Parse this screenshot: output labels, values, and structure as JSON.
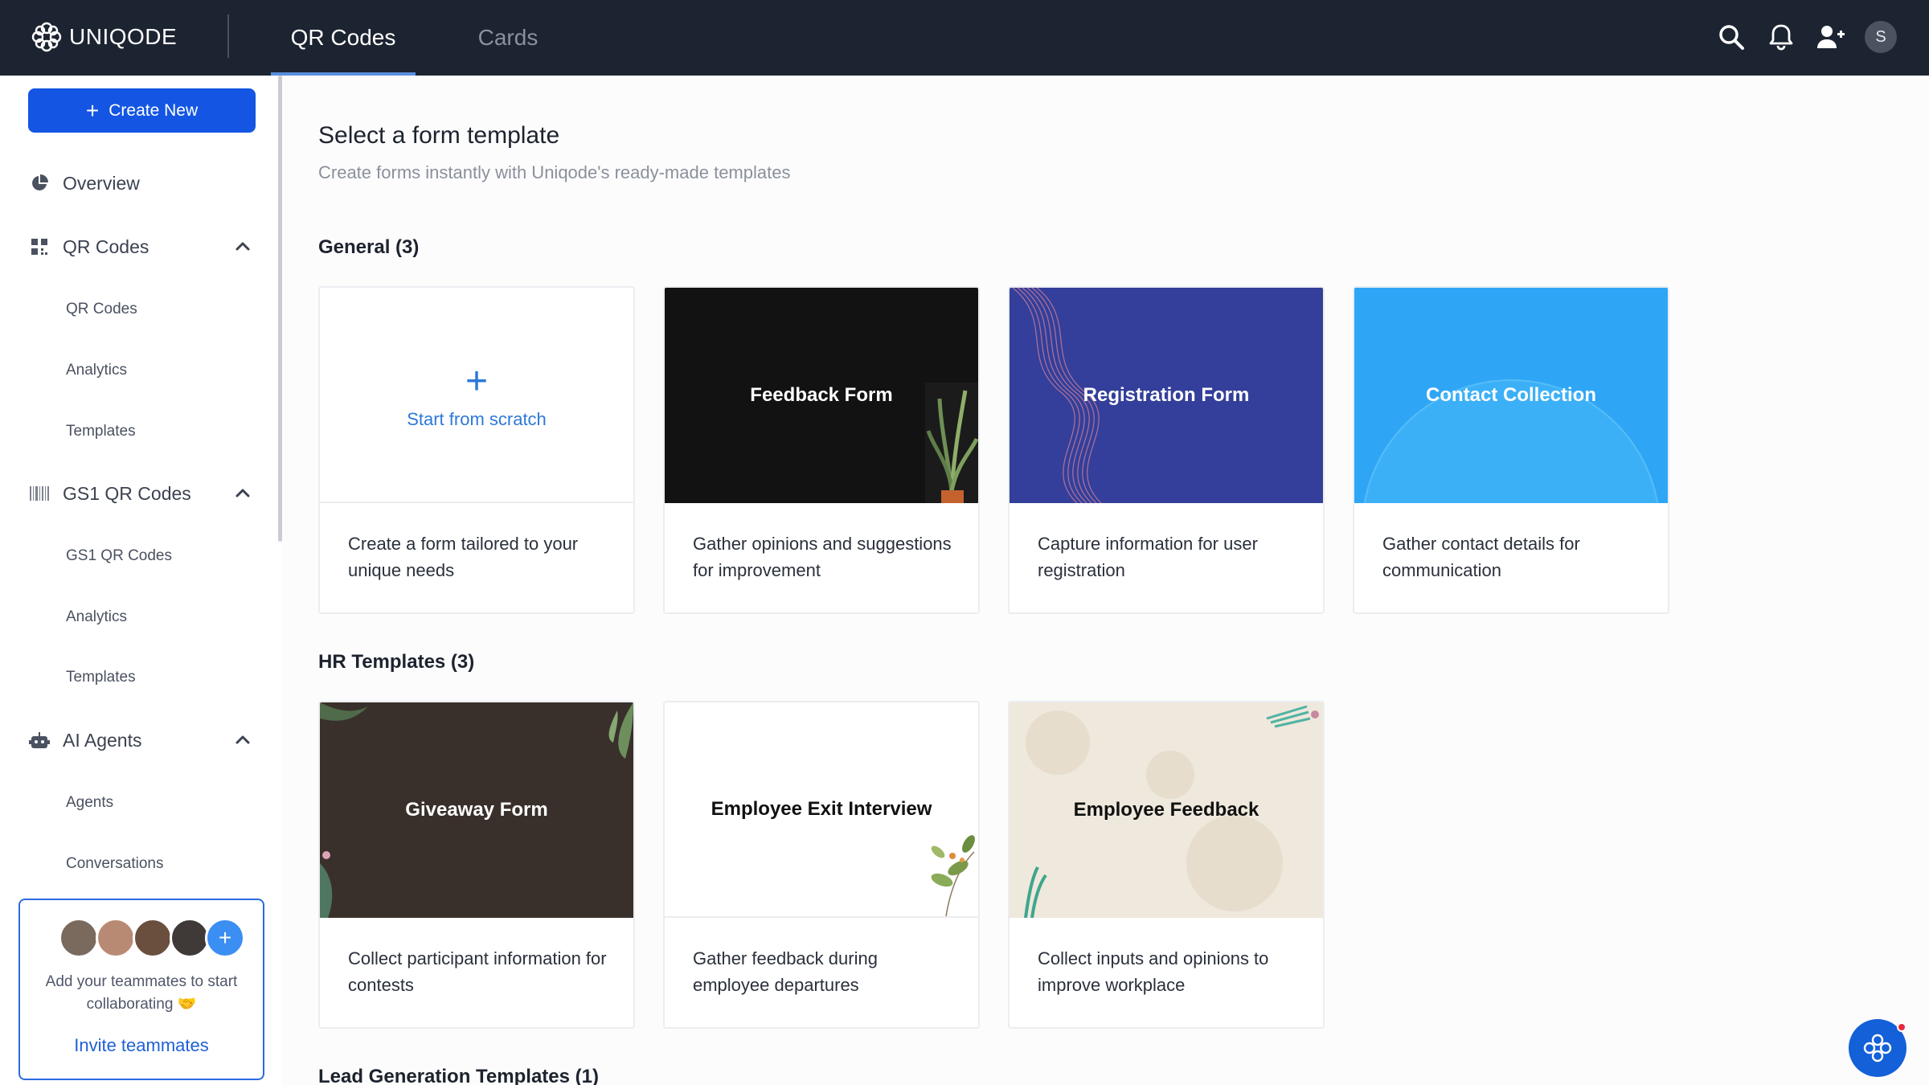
{
  "app": {
    "brand": "UNIQODE"
  },
  "topnav": {
    "tabs": [
      {
        "label": "QR Codes"
      },
      {
        "label": "Cards"
      }
    ],
    "avatar_initial": "S"
  },
  "sidebar": {
    "create_label": "Create New",
    "overview": "Overview",
    "qr_section": "QR Codes",
    "qr_items": [
      "QR Codes",
      "Analytics",
      "Templates"
    ],
    "gs1_section": "GS1 QR Codes",
    "gs1_items": [
      "GS1 QR Codes",
      "Analytics",
      "Templates"
    ],
    "ai_section": "AI Agents",
    "ai_items": [
      "Agents",
      "Conversations"
    ],
    "invite_text": "Add your teammates to start collaborating 🤝",
    "invite_link": "Invite teammates"
  },
  "main": {
    "title": "Select a form template",
    "subtitle": "Create forms instantly with Uniqode's ready-made templates",
    "sections": [
      {
        "title": "General (3)",
        "cards": [
          {
            "title": "Start from scratch",
            "desc": "Create a form tailored to your unique needs"
          },
          {
            "title": "Feedback Form",
            "desc": "Gather opinions and suggestions for improvement"
          },
          {
            "title": "Registration Form",
            "desc": "Capture information for user registration"
          },
          {
            "title": "Contact Collection",
            "desc": "Gather contact details for communication"
          }
        ]
      },
      {
        "title": "HR Templates (3)",
        "cards": [
          {
            "title": "Giveaway Form",
            "desc": "Collect participant information for contests"
          },
          {
            "title": "Employee Exit Interview",
            "desc": "Gather feedback during employee departures"
          },
          {
            "title": "Employee Feedback",
            "desc": "Collect inputs and opinions to improve workplace"
          }
        ]
      },
      {
        "title": "Lead Generation Templates (1)"
      }
    ]
  },
  "colors": {
    "topbar": "#1c2431",
    "accent": "#1456e3",
    "link": "#2d78d8"
  }
}
